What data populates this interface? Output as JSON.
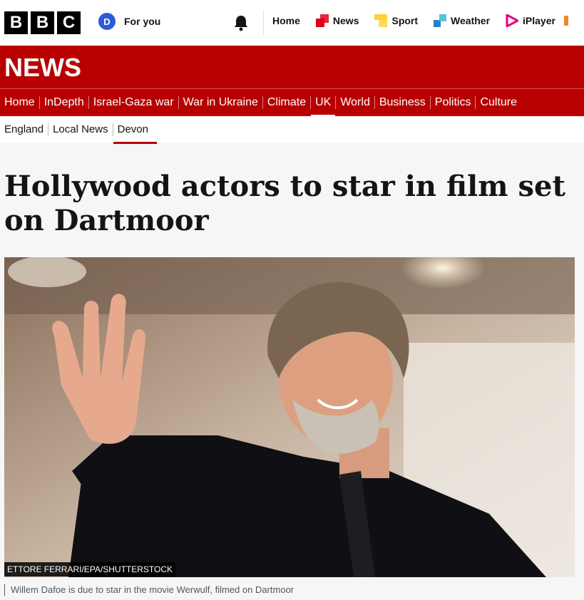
{
  "brand": {
    "logo_letters": [
      "B",
      "B",
      "C"
    ]
  },
  "account": {
    "avatar_initial": "D",
    "label": "For you"
  },
  "top_nav": [
    {
      "label": "Home",
      "icon": "none"
    },
    {
      "label": "News",
      "icon": "news-icon"
    },
    {
      "label": "Sport",
      "icon": "sport-icon"
    },
    {
      "label": "Weather",
      "icon": "weather-icon"
    },
    {
      "label": "iPlayer",
      "icon": "iplayer-icon"
    }
  ],
  "section": {
    "title": "NEWS"
  },
  "section_nav": [
    "Home",
    "InDepth",
    "Israel-Gaza war",
    "War in Ukraine",
    "Climate",
    "UK",
    "World",
    "Business",
    "Politics",
    "Culture"
  ],
  "section_nav_active": "UK",
  "sub_nav": [
    "England",
    "Local News",
    "Devon"
  ],
  "sub_nav_active": "Devon",
  "article": {
    "headline": "Hollywood actors to star in film set on Dartmoor",
    "image_credit": "ETTORE FERRARI/EPA/SHUTTERSTOCK",
    "image_caption": "Willem Dafoe is due to star in the movie Werwulf, filmed on Dartmoor"
  },
  "colors": {
    "brand_red": "#b80000",
    "avatar_blue": "#2b5bd7"
  }
}
